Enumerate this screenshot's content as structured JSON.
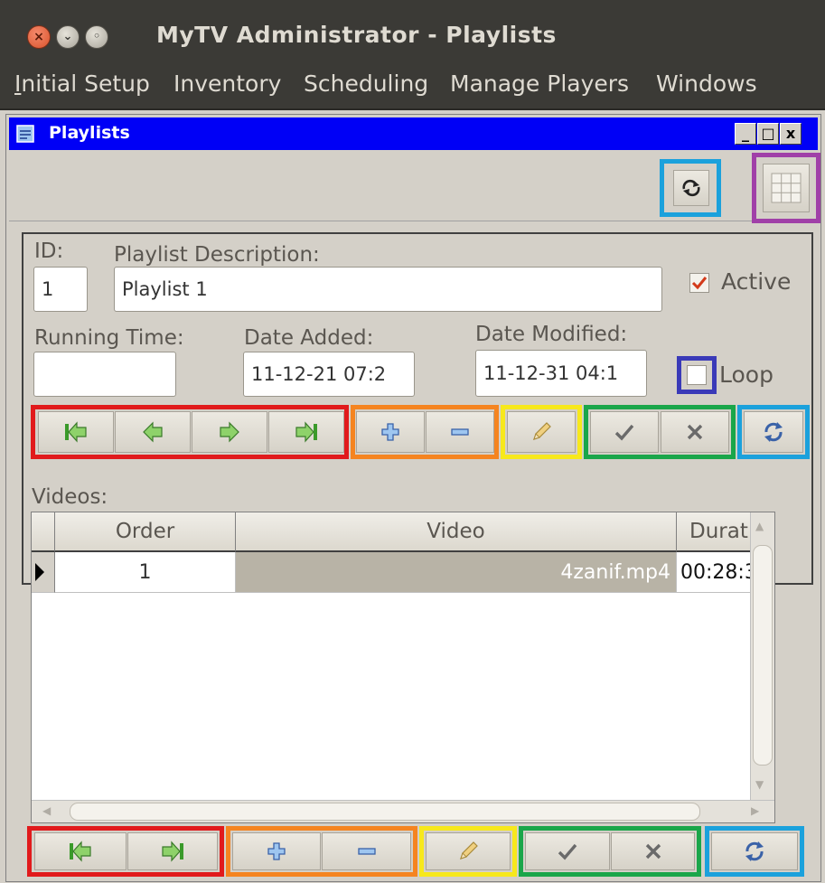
{
  "window": {
    "app_title": "MyTV Administrator - Playlists"
  },
  "menu": {
    "items": [
      {
        "label": "Initial Setup",
        "mnemonic": "I",
        "rest": "nitial Setup"
      },
      {
        "label": "Inventory"
      },
      {
        "label": "Scheduling"
      },
      {
        "label": "Manage Players"
      },
      {
        "label": "Windows"
      }
    ]
  },
  "inner_window": {
    "title": "Playlists",
    "min_glyph": "_",
    "max_glyph": "□",
    "close_glyph": "x"
  },
  "form": {
    "id_label": "ID:",
    "id_value": "1",
    "desc_label": "Playlist Description:",
    "desc_value": "Playlist 1",
    "active_label": "Active",
    "active_checked": true,
    "running_time_label": "Running Time:",
    "running_time_value": "",
    "date_added_label": "Date Added:",
    "date_added_value": "11-12-21 07:2",
    "date_modified_label": "Date Modified:",
    "date_modified_value": "11-12-31 04:1",
    "loop_label": "Loop",
    "loop_checked": false
  },
  "videos": {
    "label": "Videos:",
    "columns": [
      "Order",
      "Video",
      "Duratic"
    ],
    "rows": [
      {
        "order": "1",
        "video": "4zanif.mp4",
        "duration": "00:28:3"
      }
    ]
  },
  "colors": {
    "highlight_red": "#e11a1c",
    "highlight_orange": "#f58420",
    "highlight_yellow": "#f7e81c",
    "highlight_green": "#1aa64a",
    "highlight_blue": "#1ba1dc",
    "highlight_purple": "#a040a8",
    "highlight_navy": "#3a3ab8",
    "title_bar_blue": "#0000f6"
  },
  "icons": {
    "nav": [
      "first-record-icon",
      "previous-record-icon",
      "next-record-icon",
      "last-record-icon"
    ],
    "edit": [
      "add-icon",
      "delete-icon",
      "edit-pencil-icon",
      "confirm-check-icon",
      "cancel-x-icon",
      "refresh-icon"
    ],
    "toolbar": [
      "sync-icon",
      "grid-view-icon"
    ]
  }
}
